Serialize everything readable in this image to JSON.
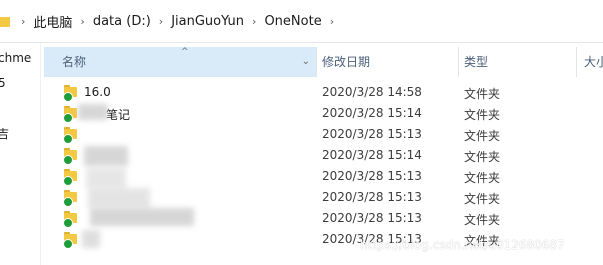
{
  "address_bar": {
    "crumbs": [
      "此电脑",
      "data (D:)",
      "JianGuoYun",
      "OneNote"
    ],
    "separator": "›"
  },
  "navigation_pane": {
    "items": [
      "chme",
      "5",
      "吉"
    ]
  },
  "columns": {
    "name": "名称",
    "date_modified": "修改日期",
    "type": "类型",
    "size": "大小"
  },
  "files": [
    {
      "name": "16.0",
      "date": "2020/3/28 14:58",
      "type": "文件夹"
    },
    {
      "name": "笔记",
      "date": "2020/3/28 15:14",
      "type": "文件夹"
    },
    {
      "name": "",
      "date": "2020/3/28 15:13",
      "type": "文件夹"
    },
    {
      "name": "",
      "date": "2020/3/28 15:14",
      "type": "文件夹"
    },
    {
      "name": "",
      "date": "2020/3/28 15:13",
      "type": "文件夹"
    },
    {
      "name": "",
      "date": "2020/3/28 15:13",
      "type": "文件夹"
    },
    {
      "name": "",
      "date": "2020/3/28 15:13",
      "type": "文件夹"
    },
    {
      "name": "",
      "date": "2020/3/28 15:13",
      "type": "文件夹"
    }
  ],
  "watermark": "https://blog.csdn.net/u012680687",
  "colors": {
    "selected_header": "#d9ebf9",
    "folder": "#f3c843",
    "sync_check": "#1f9d3a"
  }
}
